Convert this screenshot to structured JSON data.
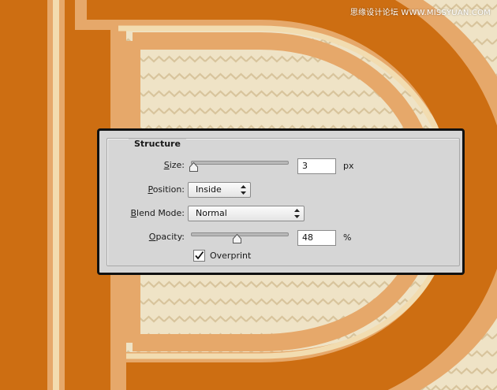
{
  "watermark": "思缘设计论坛 WWW.MISSYUAN.COM",
  "colors": {
    "letter_orange": "#cd6e12",
    "light_orange": "#e6a86a",
    "cream_stroke": "#f2dcb0",
    "pattern_bg": "#efe3c6",
    "pattern_zigzag": "#d9c7a2",
    "dialog_bg": "#d6d6d6"
  },
  "dialog": {
    "section_title": "Structure",
    "size": {
      "label_prefix": "",
      "label_accel": "S",
      "label_rest": "ize:",
      "value": "3",
      "unit": "px",
      "slider_level": 0.02
    },
    "position": {
      "label_accel": "P",
      "label_rest": "osition:",
      "selected": "Inside"
    },
    "blend_mode": {
      "label_accel": "B",
      "label_rest": "lend Mode:",
      "selected": "Normal"
    },
    "opacity": {
      "label_accel": "O",
      "label_rest": "pacity:",
      "value": "48",
      "unit": "%",
      "slider_level": 0.48
    },
    "overprint": {
      "label": "Overprint",
      "checked": true
    }
  }
}
